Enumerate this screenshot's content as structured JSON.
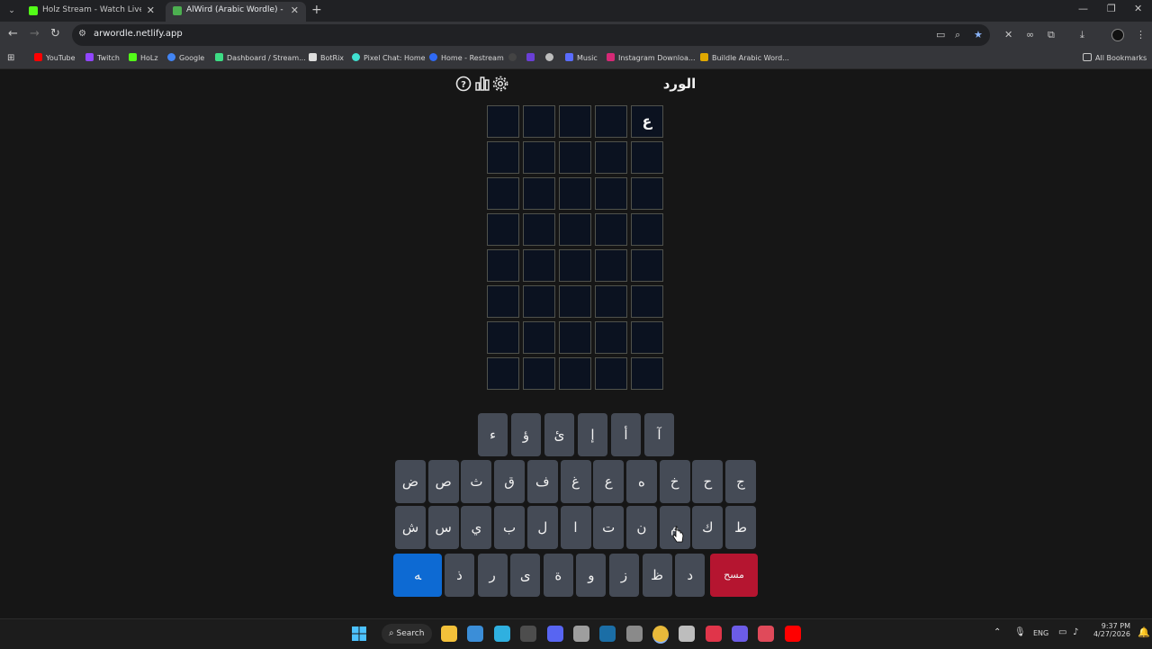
{
  "browser": {
    "tabs": [
      {
        "title": "Holz Stream - Watch Live on Ki",
        "favicon_color": "#53fc18",
        "active": false
      },
      {
        "title": "AlWird (Arabic Wordle) - الورد",
        "favicon_color": "#4caf50",
        "active": true
      }
    ],
    "url": "arwordle.netlify.app",
    "bookmarks": [
      {
        "label": "YouTube",
        "icon_color": "#ff0000"
      },
      {
        "label": "Twitch",
        "icon_color": "#9146ff"
      },
      {
        "label": "HoLz",
        "icon_color": "#53fc18"
      },
      {
        "label": "Google",
        "icon_color": "#4285f4"
      },
      {
        "label": "Dashboard / Stream...",
        "icon_color": "#3ddc84"
      },
      {
        "label": "BotRix",
        "icon_color": "#dddddd"
      },
      {
        "label": "Pixel Chat: Home",
        "icon_color": "#40e0d0"
      },
      {
        "label": "Home - Restream",
        "icon_color": "#2f6af5"
      },
      {
        "label": "Music",
        "icon_color": "#5a6cff"
      },
      {
        "label": "Instagram Downloa...",
        "icon_color": "#d62976"
      },
      {
        "label": "Buildle Arabic Word...",
        "icon_color": "#e0a800"
      }
    ],
    "all_bookmarks_label": "All Bookmarks"
  },
  "app": {
    "title": "الورد",
    "icons": [
      "help-icon",
      "stats-icon",
      "settings-icon"
    ],
    "grid": [
      [
        "",
        "",
        "",
        "",
        "ع"
      ],
      [
        "",
        "",
        "",
        "",
        ""
      ],
      [
        "",
        "",
        "",
        "",
        ""
      ],
      [
        "",
        "",
        "",
        "",
        ""
      ],
      [
        "",
        "",
        "",
        "",
        ""
      ],
      [
        "",
        "",
        "",
        "",
        ""
      ],
      [
        "",
        "",
        "",
        "",
        ""
      ],
      [
        "",
        "",
        "",
        "",
        ""
      ]
    ],
    "keyboard": {
      "row1": [
        "ء",
        "ؤ",
        "ئ",
        "إ",
        "أ",
        "آ"
      ],
      "row2": [
        "ض",
        "ص",
        "ث",
        "ق",
        "ف",
        "غ",
        "ع",
        "ه",
        "خ",
        "ح",
        "ج"
      ],
      "row3": [
        "ش",
        "س",
        "ي",
        "ب",
        "ل",
        "ا",
        "ت",
        "ن",
        "م",
        "ك",
        "ط"
      ],
      "row4": [
        "ﻪ",
        "ذ",
        "ر",
        "ى",
        "ة",
        "و",
        "ز",
        "ظ",
        "د",
        "مسح"
      ]
    },
    "colors": {
      "enter": "#0d6ad3",
      "delete": "#b51530",
      "key": "#454b56",
      "cell": "#0b1220"
    }
  },
  "taskbar": {
    "search_label": "Search",
    "language": "ENG",
    "time": "9:37 PM",
    "date": "4/27/2026",
    "app_icons": [
      {
        "name": "file-explorer-icon",
        "color": "#f3c13a"
      },
      {
        "name": "store-icon",
        "color": "#3b8ed8"
      },
      {
        "name": "edge-icon",
        "color": "#2fb0e0"
      },
      {
        "name": "terminal-icon",
        "color": "#4d4d4d"
      },
      {
        "name": "discord-icon",
        "color": "#5865f2"
      },
      {
        "name": "settings-app-icon",
        "color": "#9e9e9e"
      },
      {
        "name": "steam-icon",
        "color": "#1b6ea6"
      },
      {
        "name": "media-icon",
        "color": "#8a8a8a"
      },
      {
        "name": "chrome-icon",
        "color": "#e8b93a"
      },
      {
        "name": "app-icon",
        "color": "#bdbdbd"
      },
      {
        "name": "acrobat-icon",
        "color": "#e0354a"
      },
      {
        "name": "app-purple-icon",
        "color": "#6c5ce7"
      },
      {
        "name": "obs-icon",
        "color": "#e04a5a"
      },
      {
        "name": "youtube-icon",
        "color": "#ff0000"
      }
    ]
  }
}
